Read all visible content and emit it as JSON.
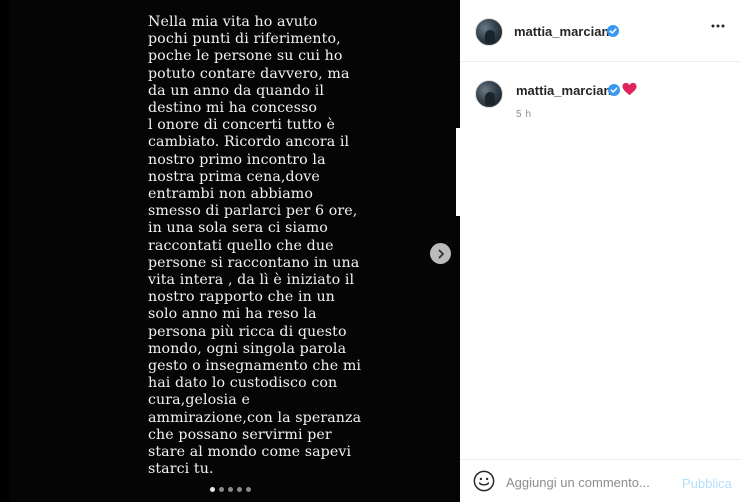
{
  "post": {
    "story_lines": [
      "Nella mia vita ho avuto",
      "pochi punti di riferimento,",
      "poche le persone su cui ho",
      "potuto contare davvero, ma",
      "da un anno da quando il",
      "destino mi ha concesso",
      "l onore di concerti tutto è",
      "cambiato. Ricordo ancora il",
      "nostro primo incontro la",
      "nostra prima cena,dove",
      "entrambi non abbiamo",
      "smesso di parlarci per 6 ore,",
      "in una sola sera ci siamo",
      "raccontati quello che due",
      "persone si raccontano in una",
      "vita intera , da lì è iniziato il",
      "nostro rapporto che in un",
      "solo anno mi ha reso la",
      "persona più ricca di questo",
      "mondo, ogni singola parola",
      "gesto o insegnamento che mi",
      "hai dato lo custodisco con",
      "cura,gelosia e",
      "ammirazione,con la speranza",
      "che possano servirmi per",
      "stare al mondo come sapevi",
      "starci tu."
    ],
    "carousel": {
      "total": 5,
      "active": 1
    },
    "icons": {
      "next": "chevron-right-icon"
    }
  },
  "header": {
    "username": "mattia_marciano",
    "icons": {
      "verified": "verified-badge-icon",
      "more": "more-options-icon"
    }
  },
  "caption": {
    "username": "mattia_marciano",
    "time_ago": "5 h",
    "icons": {
      "heart": "red-heart-emoji"
    }
  },
  "comment_box": {
    "placeholder": "Aggiungi un commento...",
    "publish_label": "Pubblica",
    "icons": {
      "emoji": "smiley-face-icon"
    }
  },
  "colors": {
    "verified_blue": "#3897f0",
    "heart_red": "#e0245e",
    "publish_disabled": "#b2dffc"
  }
}
